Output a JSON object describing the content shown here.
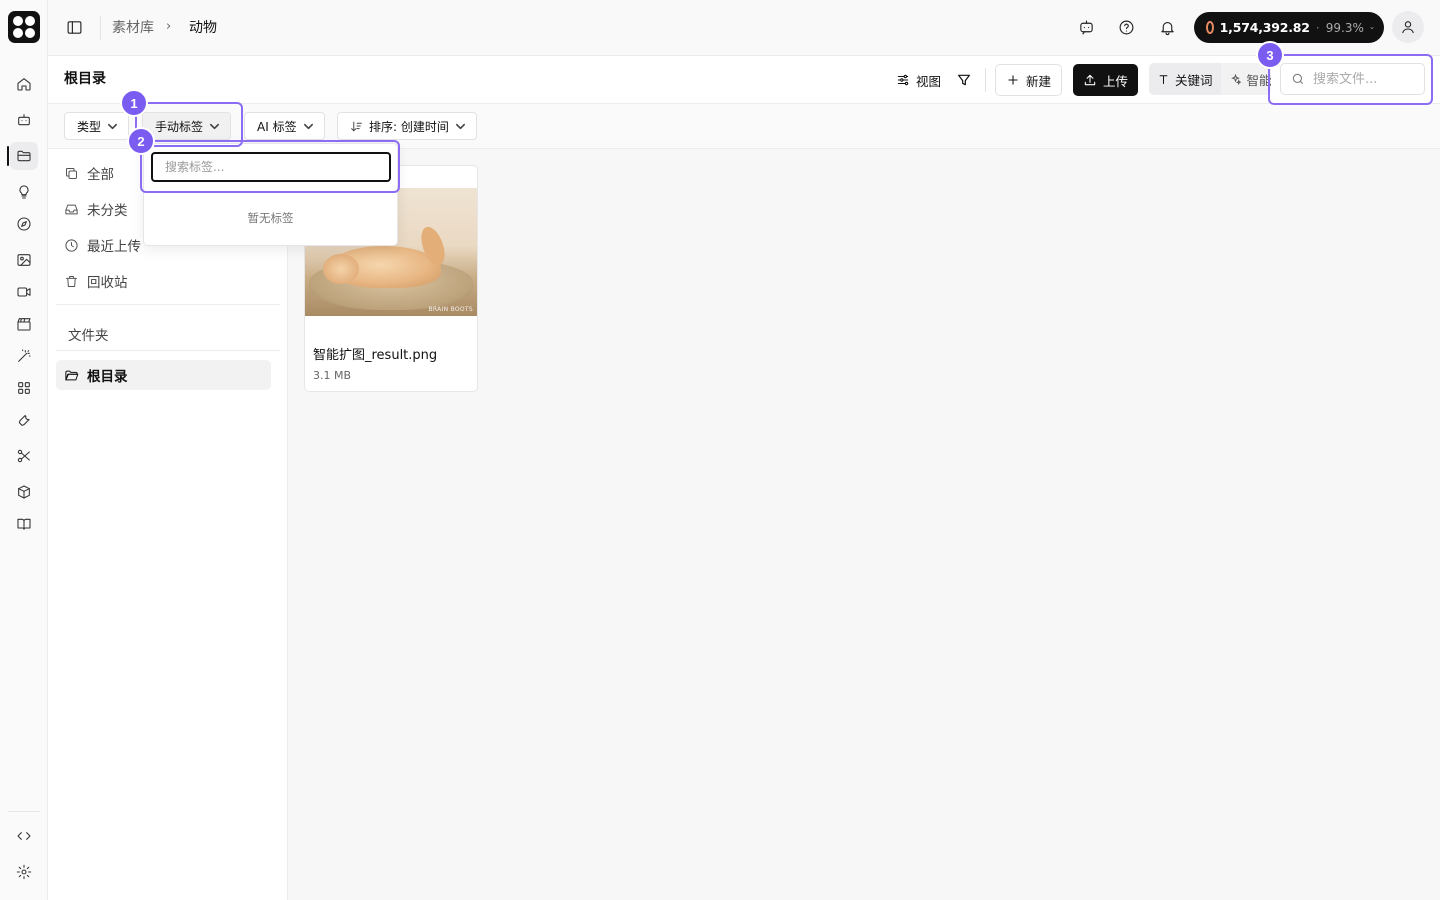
{
  "header": {
    "breadcrumb_root": "素材库",
    "breadcrumb_current": "动物",
    "credits_amount": "1,574,392.82",
    "credits_separator": "·",
    "credits_percent": "99.3%"
  },
  "toolbar": {
    "page_title": "根目录",
    "view_label": "视图",
    "new_label": "新建",
    "upload_label": "上传",
    "keyword_label": "关键词",
    "smart_label": "智能",
    "search_placeholder": "搜索文件..."
  },
  "filters": {
    "type_label": "类型",
    "manual_tag_label": "手动标签",
    "ai_tag_label": "AI 标签",
    "sort_label": "排序: 创建时间"
  },
  "tag_dropdown": {
    "search_placeholder": "搜索标签...",
    "empty_text": "暂无标签"
  },
  "sidebar": {
    "items": [
      {
        "label": "全部",
        "icon": "copy-icon"
      },
      {
        "label": "未分类",
        "icon": "inbox-icon"
      },
      {
        "label": "最近上传",
        "icon": "clock-icon"
      },
      {
        "label": "回收站",
        "icon": "trash-icon"
      }
    ],
    "folder_section_label": "文件夹",
    "folders": [
      {
        "label": "根目录",
        "icon": "folder-open-icon"
      }
    ]
  },
  "files": [
    {
      "name": "智能扩图_result.png",
      "size": "3.1 MB",
      "watermark": "BRAIN BOOTS"
    }
  ],
  "annotations": [
    {
      "label": "1"
    },
    {
      "label": "2"
    },
    {
      "label": "3"
    }
  ],
  "colors": {
    "annotation": "#8b6cf3",
    "badge": "#7b5cf0",
    "primary_button": "#111111",
    "credits_coin": "#e88b62"
  }
}
